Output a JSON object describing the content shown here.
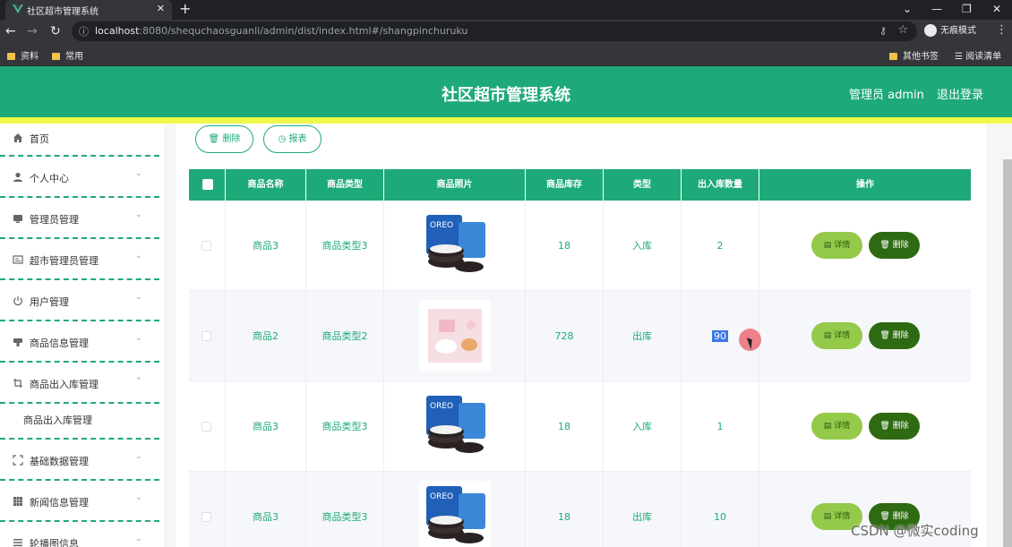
{
  "browser": {
    "tab_title": "社区超市管理系统",
    "url_host": "localhost",
    "url_rest": ":8080/shequchaosguanli/admin/dist/index.html#/shangpinchuruku",
    "incognito_label": "无痕模式",
    "bookmarks": [
      "资料",
      "常用"
    ],
    "other_bookmarks": "其他书签",
    "reading_list": "阅读清单"
  },
  "header": {
    "title": "社区超市管理系统",
    "admin_label": "管理员 admin",
    "logout": "退出登录",
    "bg_color": "#1eaa78"
  },
  "sidebar": {
    "items": [
      {
        "label": "首页",
        "icon": "home-icon"
      },
      {
        "label": "个人中心",
        "icon": "user-icon"
      },
      {
        "label": "管理员管理",
        "icon": "monitor-icon"
      },
      {
        "label": "超市管理员管理",
        "icon": "card-icon"
      },
      {
        "label": "用户管理",
        "icon": "power-icon"
      },
      {
        "label": "商品信息管理",
        "icon": "goods-icon"
      },
      {
        "label": "商品出入库管理",
        "icon": "crop-icon"
      },
      {
        "label": "基础数据管理",
        "icon": "fullscreen-icon"
      },
      {
        "label": "新闻信息管理",
        "icon": "grid-icon"
      },
      {
        "label": "轮播图信息",
        "icon": "list-icon"
      }
    ],
    "sub_item": "商品出入库管理"
  },
  "toolbar": {
    "delete_label": "删除",
    "report_label": "报表"
  },
  "table": {
    "headers": [
      "商品名称",
      "商品类型",
      "商品照片",
      "商品库存",
      "类型",
      "出入库数量",
      "操作"
    ],
    "rows": [
      {
        "name": "商品3",
        "category": "商品类型3",
        "photo": "oreo",
        "stock": "18",
        "type": "入库",
        "qty": "2"
      },
      {
        "name": "商品2",
        "category": "商品类型2",
        "photo": "pink",
        "stock": "728",
        "type": "出库",
        "qty": "90"
      },
      {
        "name": "商品3",
        "category": "商品类型3",
        "photo": "oreo",
        "stock": "18",
        "type": "入库",
        "qty": "1"
      },
      {
        "name": "商品3",
        "category": "商品类型3",
        "photo": "oreo",
        "stock": "18",
        "type": "出库",
        "qty": "10"
      }
    ],
    "detail_label": "详情",
    "delete_label": "删除"
  },
  "watermark": "CSDN @微实coding"
}
